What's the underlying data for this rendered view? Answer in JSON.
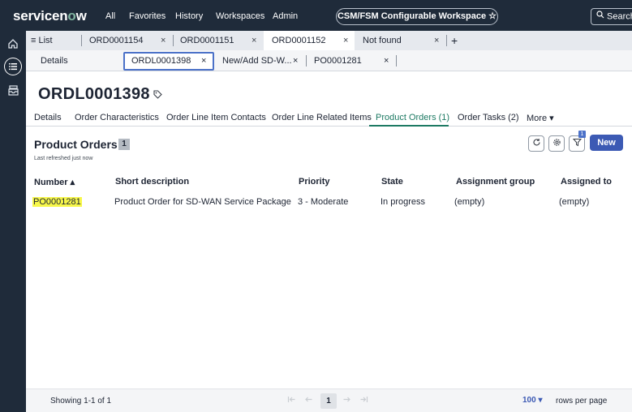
{
  "topbar": {
    "logo_a": "servicen",
    "logo_o": "o",
    "logo_b": "w",
    "nav": [
      "All",
      "Favorites",
      "History",
      "Workspaces",
      "Admin"
    ],
    "workspace": "CSM/FSM Configurable Workspace ☆",
    "search_label": "Search"
  },
  "tabs_row1": [
    {
      "label": "≡ List"
    },
    {
      "label": "ORD0001154",
      "close": "×"
    },
    {
      "label": "ORD0001151",
      "close": "×"
    },
    {
      "label": "ORD0001152",
      "close": "×"
    },
    {
      "label": "Not found",
      "close": "×"
    },
    {
      "label": "+"
    }
  ],
  "tabs_row2": [
    {
      "label": "Details"
    },
    {
      "label": "ORDL0001398",
      "close": "×"
    },
    {
      "label": "New/Add SD-W...",
      "close": "×"
    },
    {
      "label": "PO0001281",
      "close": "×"
    }
  ],
  "record": {
    "title": "ORDL0001398"
  },
  "record_tabs": [
    "Details",
    "Order Characteristics",
    "Order Line Item Contacts",
    "Order Line Related Items",
    "Product Orders (1)",
    "Order Tasks (2)",
    "More ▾"
  ],
  "panel": {
    "title": "Product Orders",
    "count": "1",
    "refreshed": "Last refreshed just now",
    "filter_badge": "1",
    "new_label": "New"
  },
  "table": {
    "headers": [
      "Number ▴",
      "Short description",
      "Priority",
      "State",
      "Assignment group",
      "Assigned to"
    ],
    "rows": [
      [
        "PO0001281",
        "Product Order for SD-WAN Service Package",
        "3 - Moderate",
        "In progress",
        "(empty)",
        "(empty)"
      ]
    ]
  },
  "footer": {
    "showing": "Showing 1-1 of 1",
    "page": "1",
    "rows_value": "100 ▾",
    "rows_label": "rows per page"
  },
  "colors": {
    "topbar": "#1f2b3a",
    "accent": "#3c5ab4",
    "active_tab": "#1d7a63",
    "highlight": "#f7f74a"
  }
}
